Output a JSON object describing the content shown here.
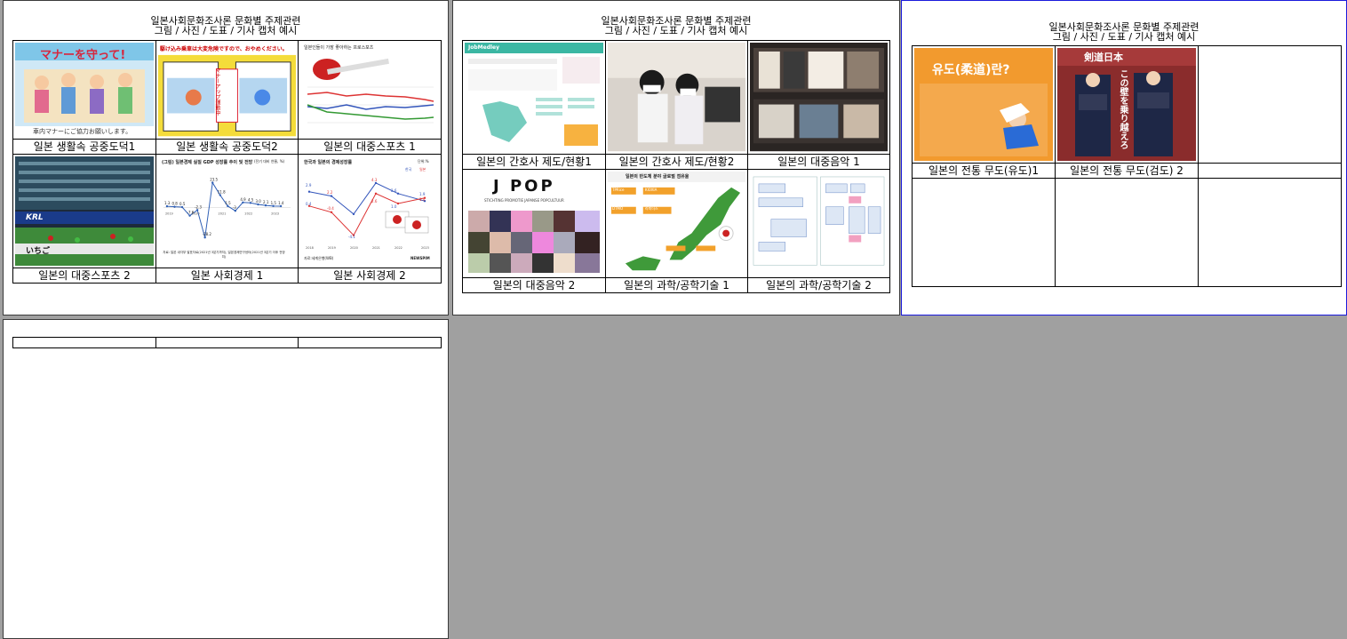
{
  "doc_title": {
    "line1": "일본사회문화조사론 문화별 주제관련",
    "line2": "그림 / 사진 / 도표 / 기사 캡처 예시"
  },
  "page1": {
    "captions": [
      "일본 생활속 공중도덕1",
      "일본 생활속 공중도덕2",
      "일본의 대중스포츠 1",
      "일본의 대중스포츠 2",
      "일본 사회경제 1",
      "일본 사회경제 2"
    ],
    "poster1_text": "マナーを守って!",
    "poster1_footer": "車内マナーにご協力お願いします。",
    "poster2_text": "駆け込み乗車は大変危険ですので、おやめください。",
    "poster2_sign": "マナーアップ運動中",
    "chart1_title": "일본인들이 가장 좋아하는 프로스포츠",
    "stadium_banner": "KRL",
    "stadium_banner2": "いちご",
    "gdp_title": "(그림) 일본경제 실질 GDP 성장률 추이 및 전망",
    "gdp_unit": "(전기 대비 연율, %)",
    "gdp_labels": [
      "1.3",
      "0.8",
      "0.5",
      "-7.6",
      "-2.3",
      "-28.2",
      "23.5",
      "11.8",
      "1.5",
      "-3",
      "4.9",
      "4.5",
      "3.0",
      "2.1",
      "1.5",
      "1.4"
    ],
    "gdp_years": [
      "2019",
      "2020",
      "2021",
      "2022",
      "2023"
    ],
    "gdp_source": "자료: 일본 내각부 발표자료(2021년 3분기까지), 일본경제연구센터(2021년 3분기 이후 전망치)",
    "kj_title": "한국과 일본의 경제성장률",
    "kj_unit": "단위:%",
    "kj_legend": [
      "한국",
      "일본"
    ],
    "kj_labels": [
      "2.9",
      "2.2",
      "0.4",
      "-0.4",
      "-4.1",
      "4.3",
      "2.6",
      "2.6",
      "1.0",
      "1.4",
      "1.9"
    ],
    "kj_years": [
      "2018",
      "2019",
      "2020",
      "2021",
      "2022",
      "2023"
    ],
    "kj_source": "자료:세계은행(WB)",
    "kj_brand": "NEWSPIM"
  },
  "page2": {
    "captions": [
      "일본의 간호사 제도/현황1",
      "일본의 간호사 제도/현황2",
      "일본의 대중음악 1",
      "일본의 대중음악 2",
      "일본의 과학/공학기술 1",
      "일본의 과학/공학기술 2"
    ],
    "jobsite_logo": "JobMedley",
    "jpop_logo": "J POP",
    "jpop_subtitle": "STICHTING PROMOTIE JAPANSE POPCULTUUR",
    "map_title": "일본의 반도체 분야 글로벌 점유율",
    "map_tags": [
      "TPRice",
      "DTMO",
      "KIOXIA",
      "라피더스"
    ]
  },
  "page3": {
    "captions": [
      "일본의 전통 무도(유도)1",
      "일본의 전통 무도(검도) 2",
      "",
      "",
      "",
      ""
    ],
    "judo_title": "유도(柔道)란?",
    "kendo_mag": "剣道日本",
    "kendo_title": "この壁を乗り越えろ"
  },
  "page4": {
    "captions": [
      "",
      "",
      ""
    ]
  }
}
